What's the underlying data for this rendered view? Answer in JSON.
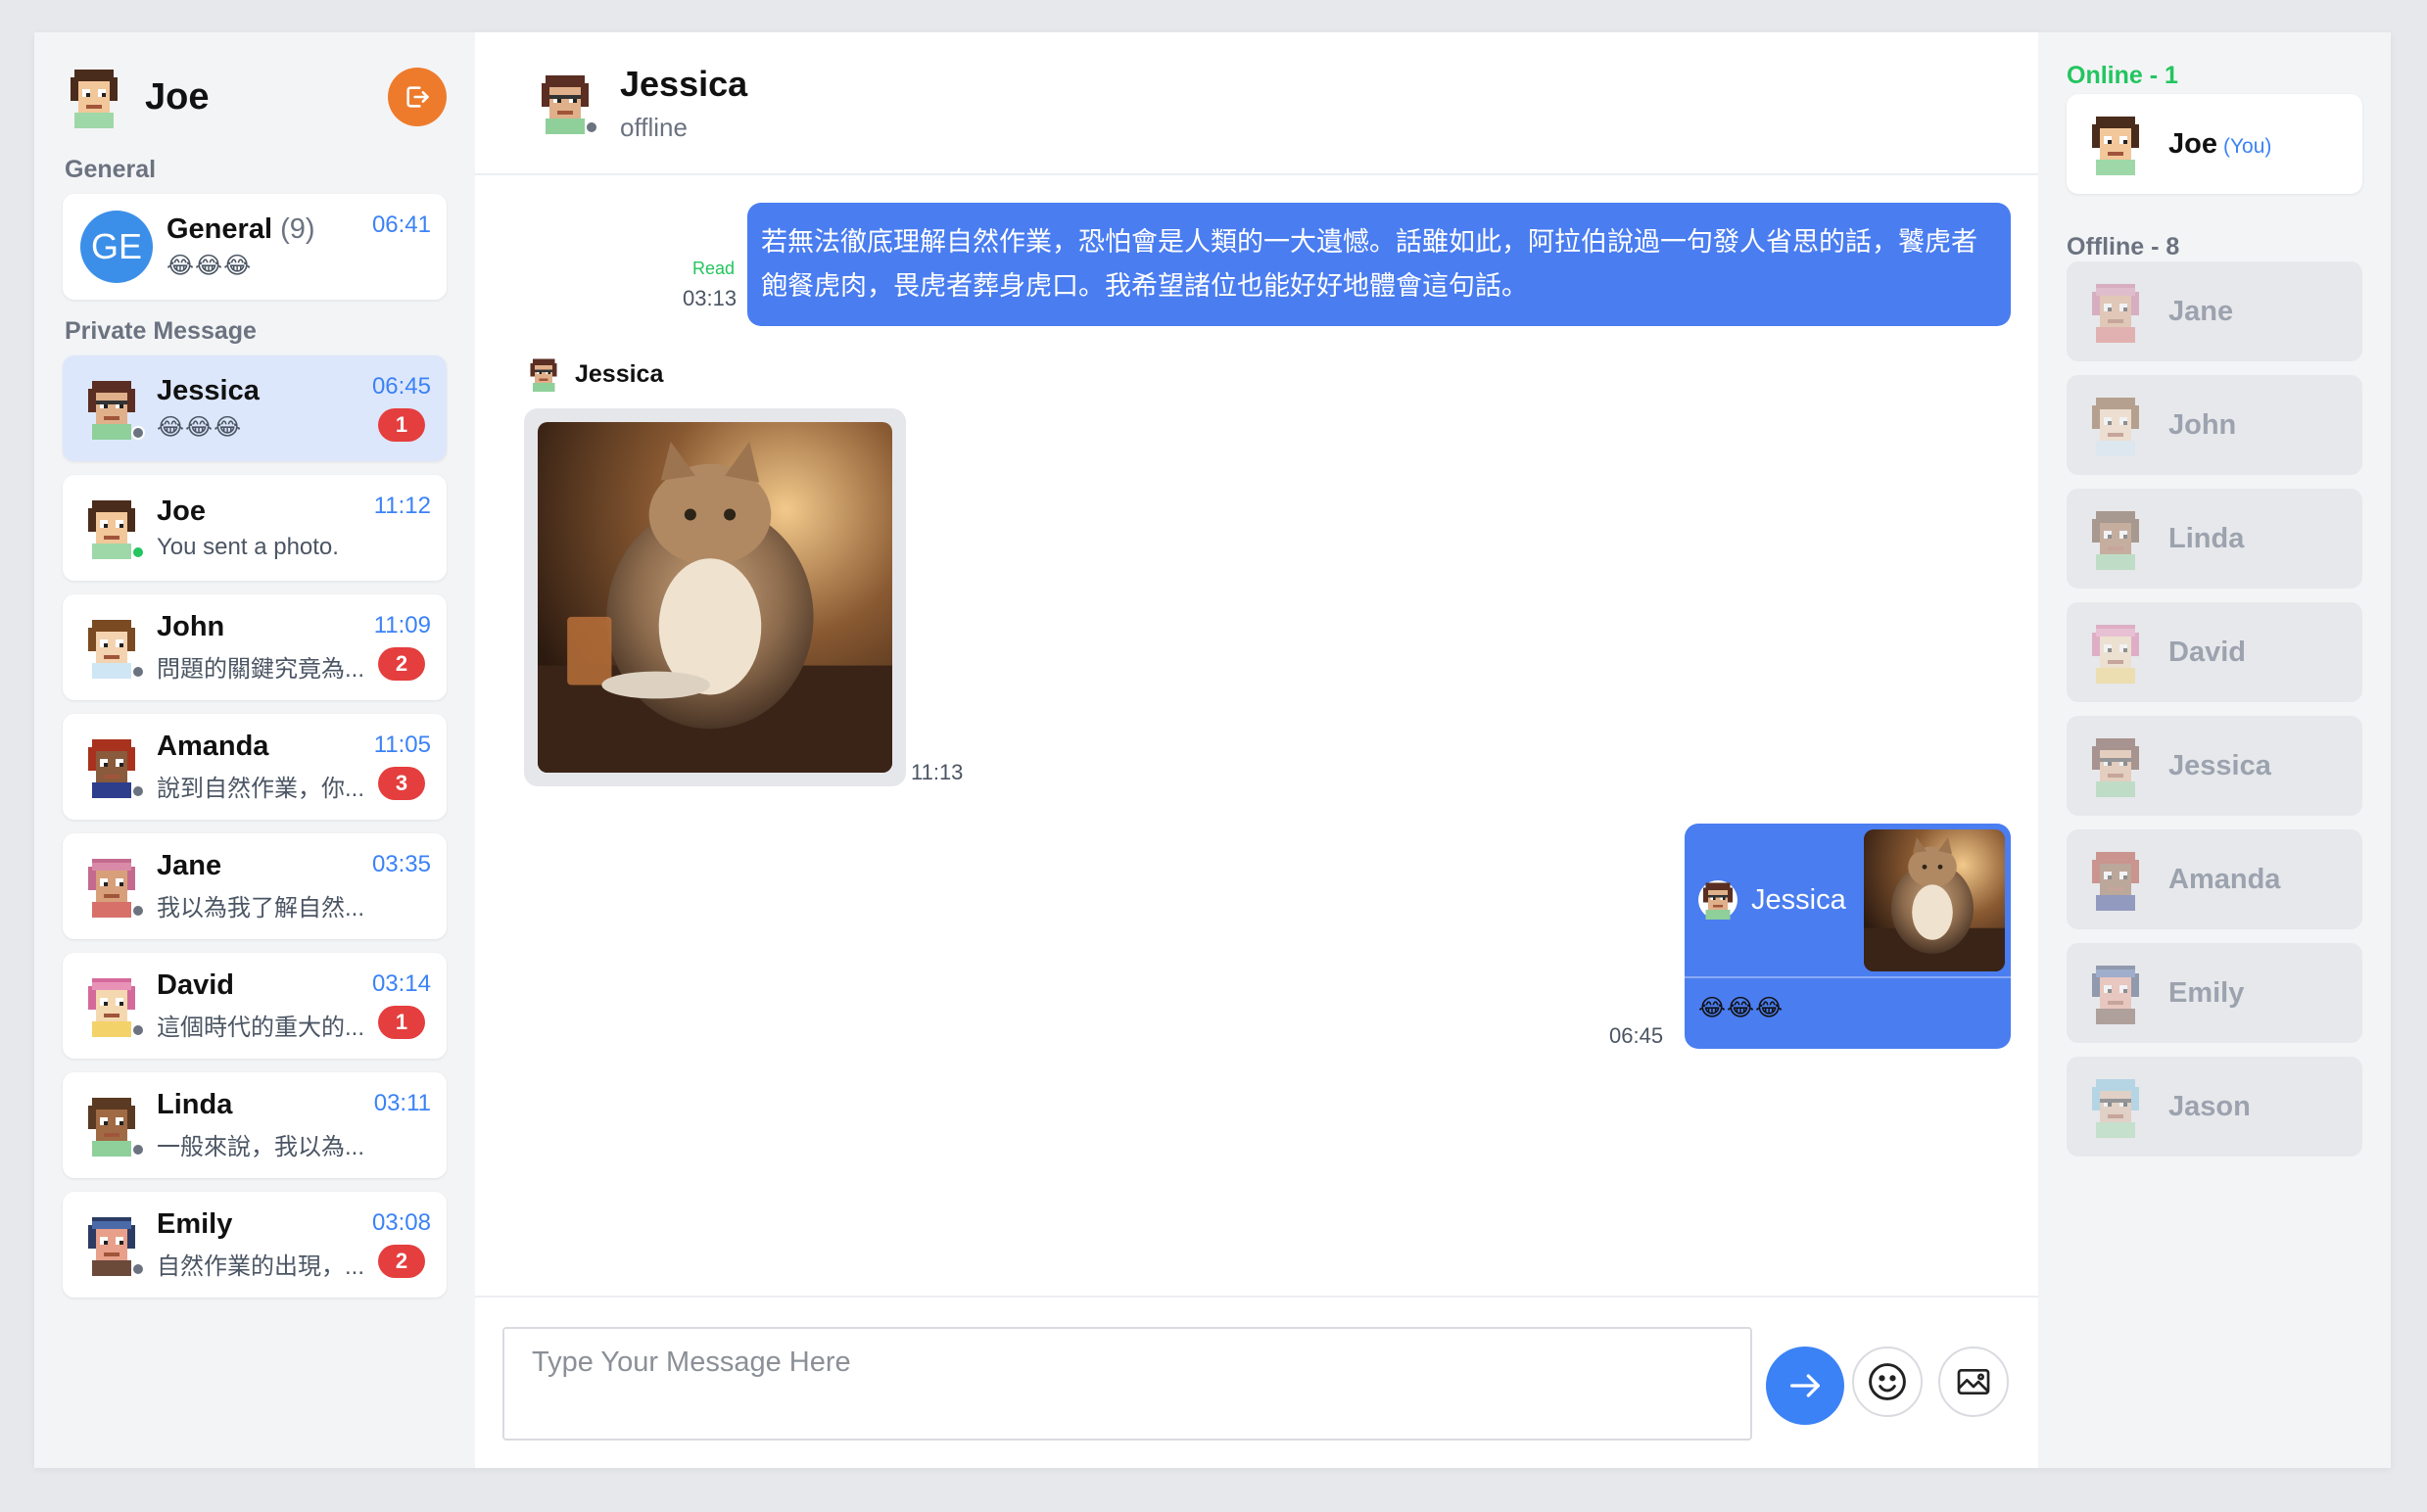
{
  "me": {
    "name": "Joe"
  },
  "sidebar": {
    "general_label": "General",
    "private_label": "Private Message",
    "general": {
      "initials": "GE",
      "name": "General",
      "count": "(9)",
      "time": "06:41",
      "preview": "😂😂😂"
    },
    "private": [
      {
        "name": "Jessica",
        "time": "06:45",
        "preview": "😂😂😂",
        "badge": "1"
      },
      {
        "name": "Joe",
        "time": "11:12",
        "preview": "You sent a photo.",
        "badge": ""
      },
      {
        "name": "John",
        "time": "11:09",
        "preview": "問題的關鍵究竟為...",
        "badge": "2"
      },
      {
        "name": "Amanda",
        "time": "11:05",
        "preview": "說到自然作業，你...",
        "badge": "3"
      },
      {
        "name": "Jane",
        "time": "03:35",
        "preview": "我以為我了解自然...",
        "badge": ""
      },
      {
        "name": "David",
        "time": "03:14",
        "preview": "這個時代的重大的...",
        "badge": "1"
      },
      {
        "name": "Linda",
        "time": "03:11",
        "preview": "一般來說，我以為...",
        "badge": ""
      },
      {
        "name": "Emily",
        "time": "03:08",
        "preview": "自然作業的出現，...",
        "badge": "2"
      }
    ]
  },
  "chat": {
    "contact_name": "Jessica",
    "contact_status": "offline",
    "messages": [
      {
        "from": "me",
        "text": "若無法徹底理解自然作業，恐怕會是人類的一大遺憾。話雖如此，阿拉伯說過一句發人省思的話，饕虎者飽餐虎肉，畏虎者葬身虎口。我希望諸位也能好好地體會這句話。",
        "status": "Read",
        "time": "03:13"
      },
      {
        "from": "Jessica",
        "sender": "Jessica",
        "type": "photo",
        "time": "11:13"
      },
      {
        "from": "me",
        "reply_to": "Jessica",
        "text": "😂😂😂",
        "time": "06:45"
      }
    ],
    "composer": {
      "placeholder": "Type Your Message Here"
    }
  },
  "users": {
    "online_label": "Online - 1",
    "offline_label": "Offline - 8",
    "online": [
      {
        "name": "Joe",
        "tag": "(You)"
      }
    ],
    "offline": [
      {
        "name": "Jane"
      },
      {
        "name": "John"
      },
      {
        "name": "Linda"
      },
      {
        "name": "David"
      },
      {
        "name": "Jessica"
      },
      {
        "name": "Amanda"
      },
      {
        "name": "Emily"
      },
      {
        "name": "Jason"
      }
    ]
  },
  "colors": {
    "accent": "#3b82f6",
    "bubble": "#4a7df0",
    "online": "#22c55e",
    "badge": "#e53e3e",
    "logout": "#ee7b2c"
  }
}
